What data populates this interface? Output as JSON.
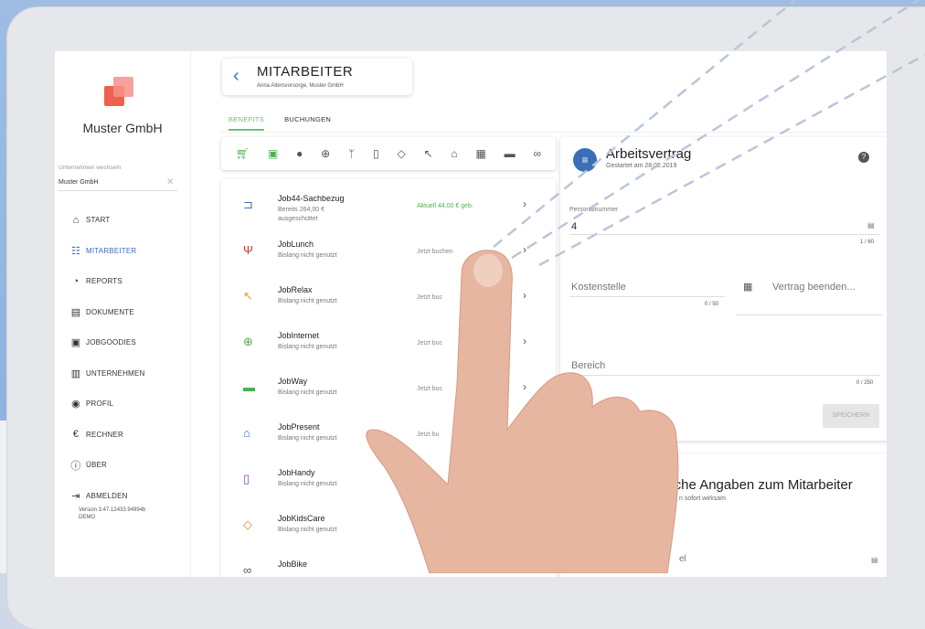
{
  "company": {
    "name": "Muster GmbH"
  },
  "company_switch": {
    "label": "Unternehmen wechseln",
    "value": "Muster GmbH"
  },
  "sidebar": {
    "items": [
      {
        "label": "START",
        "icon": "home-icon"
      },
      {
        "label": "MITARBEITER",
        "icon": "people-icon"
      },
      {
        "label": "REPORTS",
        "icon": "reports-icon"
      },
      {
        "label": "DOKUMENTE",
        "icon": "document-icon"
      },
      {
        "label": "JOBGOODIES",
        "icon": "gift-icon"
      },
      {
        "label": "UNTERNEHMEN",
        "icon": "building-icon"
      },
      {
        "label": "PROFIL",
        "icon": "profile-icon"
      },
      {
        "label": "RECHNER",
        "icon": "euro-icon"
      },
      {
        "label": "ÜBER",
        "icon": "info-icon"
      },
      {
        "label": "ABMELDEN",
        "icon": "logout-icon"
      }
    ],
    "version": "Version 3.47.12433.94994b",
    "env": "DEMO"
  },
  "header": {
    "title": "MITARBEITER",
    "subtitle": "Anna Altersvorsorge, Muster GmbH"
  },
  "tabs": [
    {
      "label": "BENEFITS"
    },
    {
      "label": "BUCHUNGEN"
    }
  ],
  "benefits": [
    {
      "name": "Job44-Sachbezug",
      "desc": "Bereits 264,00 € ausgeschüttet",
      "status": "Aktuell 44,00 € geb.",
      "icon": "cart-icon",
      "color": "#3b6fb5"
    },
    {
      "name": "JobLunch",
      "desc": "Bislang nicht genutzt",
      "status": "Jetzt buchen",
      "icon": "cutlery-icon",
      "color": "#c0392b"
    },
    {
      "name": "JobRelax",
      "desc": "Bislang nicht genutzt",
      "status": "Jetzt buc",
      "icon": "relax-icon",
      "color": "#e0a030"
    },
    {
      "name": "JobInternet",
      "desc": "Bislang nicht genutzt",
      "status": "Jetzt buc",
      "icon": "globe-icon",
      "color": "#4caf50"
    },
    {
      "name": "JobWay",
      "desc": "Bislang nicht genutzt",
      "status": "Jetzt buc",
      "icon": "car-icon",
      "color": "#4caf50"
    },
    {
      "name": "JobPresent",
      "desc": "Bislang nicht genutzt",
      "status": "Jetzt bu",
      "icon": "basket-icon",
      "color": "#3b6fb5"
    },
    {
      "name": "JobHandy",
      "desc": "Bislang nicht genutzt",
      "status": "Jetzt bu",
      "icon": "phone-icon",
      "color": "#8e44ad"
    },
    {
      "name": "JobKidsCare",
      "desc": "Bislang nicht genutzt",
      "status": "",
      "icon": "kids-icon",
      "color": "#e67e22"
    },
    {
      "name": "JobBike",
      "desc": "",
      "status": "",
      "icon": "bike-icon",
      "color": "#555"
    }
  ],
  "contract": {
    "title": "Arbeitsvertrag",
    "subtitle": "Gestartet am 28.02.2019",
    "personnel_label": "Personalnummer",
    "personnel_value": "4",
    "personnel_count": "1 / 60",
    "cost_center_placeholder": "Kostenstelle",
    "cost_center_count": "0 / 50",
    "end_contract_placeholder": "Vertrag beenden...",
    "area_placeholder": "Bereich",
    "area_count": "0 / 250",
    "save_label": "SPEICHERN"
  },
  "employee_info": {
    "title": "liche Angaben zum Mitarbeiter",
    "subtitle": "n sofort wirksam",
    "field_placeholder": "el"
  }
}
